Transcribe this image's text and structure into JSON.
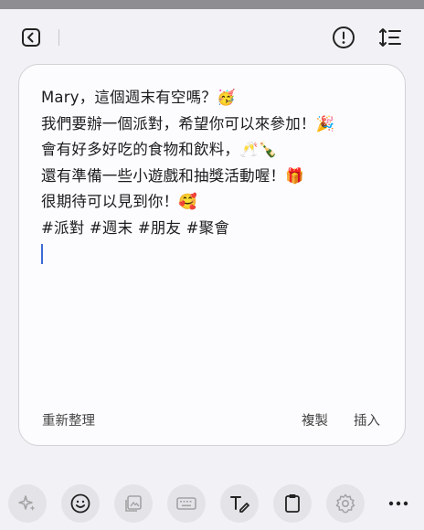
{
  "message": {
    "lines": [
      "Mary，這個週末有空嗎？🥳",
      "我們要辦一個派對，希望你可以來參加！🎉",
      "會有好多好吃的食物和飲料，🥂🍾",
      "還有準備一些小遊戲和抽獎活動喔！🎁",
      "很期待可以見到你！🥰",
      "#派對 #週末 #朋友 #聚會"
    ]
  },
  "actions": {
    "rewrite": "重新整理",
    "copy": "複製",
    "insert": "插入"
  },
  "colors": {
    "cursor": "#3d6ad6",
    "card_bg": "#fcfcfe",
    "page_bg": "#f2f2f6"
  },
  "icons": {
    "top": [
      "back-icon",
      "info-icon",
      "text-format-icon"
    ],
    "bottom": [
      "ai-sparkle-icon",
      "emoji-icon",
      "image-sticker-icon",
      "keyboard-icon",
      "handwriting-icon",
      "clipboard-icon",
      "settings-icon",
      "more-options-icon"
    ]
  }
}
